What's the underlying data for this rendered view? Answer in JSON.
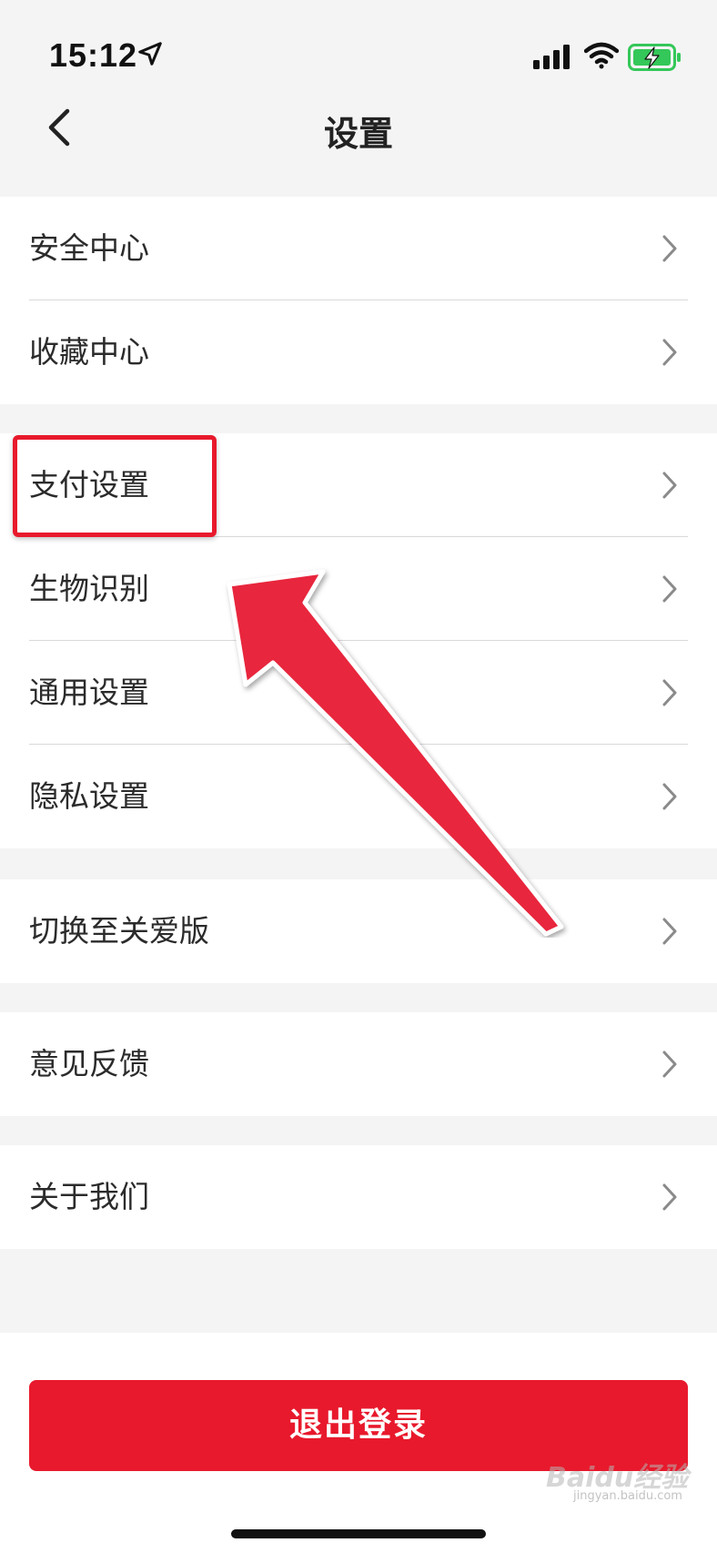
{
  "status_bar": {
    "time": "15:12",
    "icons": [
      "location-arrow-icon",
      "cellular-signal-icon",
      "wifi-icon",
      "battery-charging-icon"
    ],
    "battery_color": "#34c759"
  },
  "nav": {
    "title": "设置",
    "back_icon": "chevron-left-icon"
  },
  "groups": [
    {
      "items": [
        {
          "label": "安全中心"
        },
        {
          "label": "收藏中心"
        }
      ]
    },
    {
      "items": [
        {
          "label": "支付设置"
        },
        {
          "label": "生物识别"
        },
        {
          "label": "通用设置"
        },
        {
          "label": "隐私设置"
        }
      ]
    },
    {
      "items": [
        {
          "label": "切换至关爱版"
        }
      ]
    },
    {
      "items": [
        {
          "label": "意见反馈"
        }
      ]
    },
    {
      "items": [
        {
          "label": "关于我们"
        }
      ]
    }
  ],
  "logout": {
    "label": "退出登录"
  },
  "watermark": {
    "text": "Baidu经验",
    "sub": "jingyan.baidu.com"
  },
  "colors": {
    "accent": "#e8192c",
    "background": "#f4f4f4",
    "row_background": "#ffffff"
  }
}
